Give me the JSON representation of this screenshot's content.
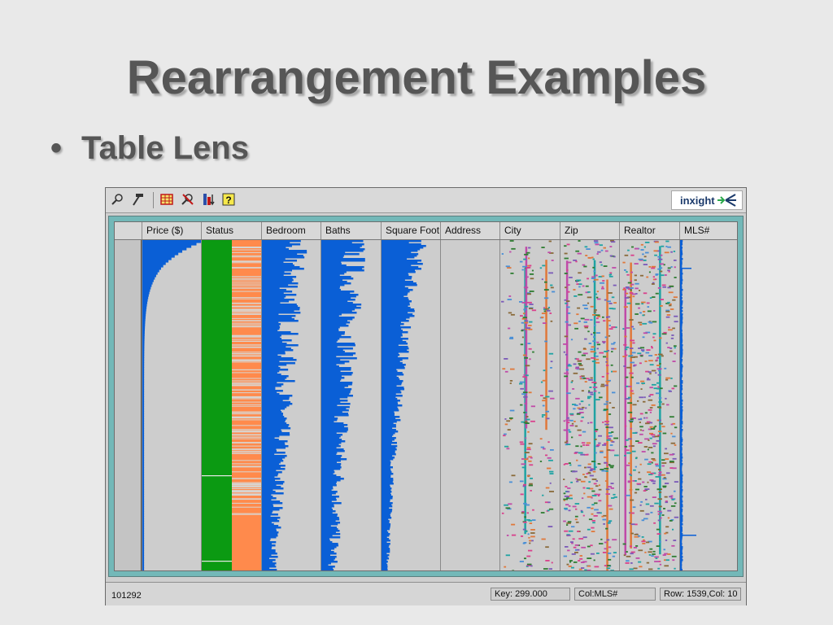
{
  "slide": {
    "title": "Rearrangement Examples",
    "bullet_mark": "•",
    "bullet_text": "Table Lens"
  },
  "toolbar": {
    "tools": [
      "zoom-icon",
      "hammer-icon",
      "spreadsheet-icon",
      "focus-icon",
      "column-sort-icon",
      "help-icon"
    ],
    "logo_text": "inxight"
  },
  "table": {
    "columns": [
      {
        "name": "Price ($)",
        "kind": "sorted-bars"
      },
      {
        "name": "Status",
        "kind": "category-blocks"
      },
      {
        "name": "Bedroom",
        "kind": "bars"
      },
      {
        "name": "Baths",
        "kind": "bars"
      },
      {
        "name": "Square Foot",
        "kind": "bars"
      },
      {
        "name": "Address",
        "kind": "empty"
      },
      {
        "name": "City",
        "kind": "nominal-marks"
      },
      {
        "name": "Zip",
        "kind": "nominal-marks"
      },
      {
        "name": "Realtor",
        "kind": "nominal-marks"
      },
      {
        "name": "MLS#",
        "kind": "bars"
      }
    ]
  },
  "statusbar": {
    "left": "101292",
    "key": "Key: 299.000",
    "col": "Col:MLS#",
    "rowcol": "Row: 1539,Col: 10"
  },
  "colors": {
    "bar_blue": "#0a5fd6",
    "status_green": "#0b9a12",
    "status_orange": "#ff8a4c",
    "teal_frame": "#73b8b8",
    "nominal_palette": [
      "#1fa3a3",
      "#c04ba8",
      "#e0783a",
      "#2e7d32",
      "#7b5ab8",
      "#4a8fd6",
      "#8a6a3a",
      "#d9418c"
    ]
  }
}
